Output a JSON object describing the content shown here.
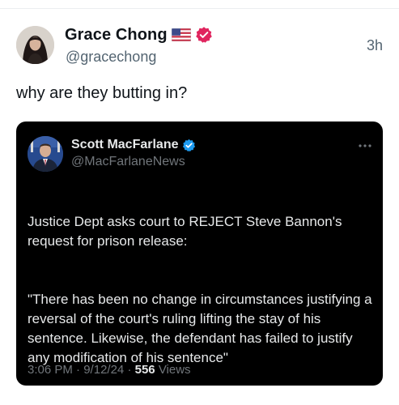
{
  "post": {
    "author": {
      "display_name": "Grace Chong",
      "handle": "@gracechong",
      "flag_icon": "us-flag-icon",
      "badge_icon": "verified-badge-icon",
      "badge_color": "#e0245e"
    },
    "timestamp": "3h",
    "text": "why are they butting in?"
  },
  "quoted_post": {
    "author": {
      "display_name": "Scott MacFarlane",
      "handle": "@MacFarlaneNews",
      "badge_icon": "verified-badge-icon",
      "badge_color": "#1d9bf0"
    },
    "more_icon": "more-horizontal-icon",
    "paragraphs": [
      "Justice Dept asks court to REJECT Steve Bannon's request for prison release:",
      "\"There has been no change in circumstances justifying a reversal of the court's ruling lifting  the stay of his sentence. Likewise, the defendant has failed to justify any modification of his sentence\""
    ],
    "time": "3:06 PM",
    "date": "9/12/24",
    "separator": "·",
    "views_count": "556",
    "views_label": "Views"
  },
  "colors": {
    "text_primary": "#0f1419",
    "text_secondary": "#536471",
    "quote_bg": "#000000",
    "quote_text": "#e7e9ea",
    "quote_secondary": "#71767b"
  }
}
